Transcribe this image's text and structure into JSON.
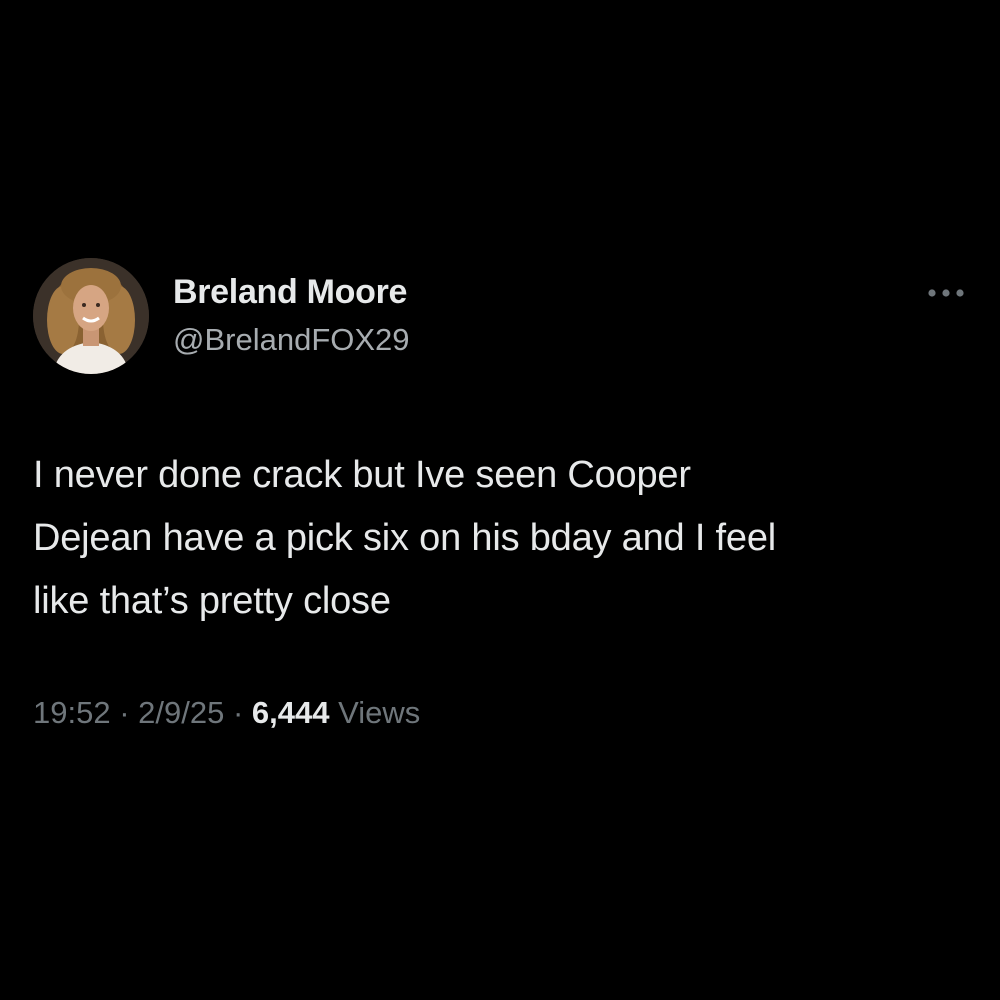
{
  "tweet": {
    "author": {
      "display_name": "Breland Moore",
      "handle": "@BrelandFOX29",
      "avatar_icon": "profile-photo"
    },
    "more_icon": "more-options-icon",
    "text": "I never done crack but Ive seen Cooper\nDejean have a pick six on his bday and I feel\nlike that’s pretty close",
    "time": "19:52",
    "date": "2/9/25",
    "separator": " · ",
    "views_count": "6,444",
    "views_label": "Views"
  },
  "colors": {
    "background": "#000000",
    "primary_text": "#e7e9ea",
    "secondary_text": "#6f767b",
    "handle_text": "#a7acb0"
  }
}
